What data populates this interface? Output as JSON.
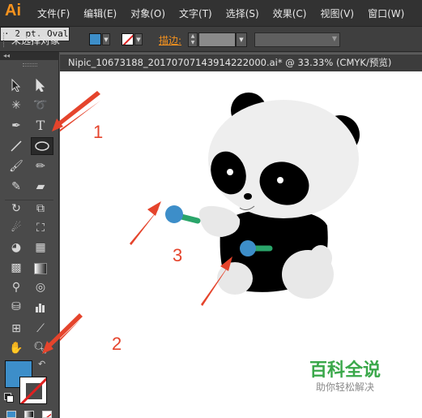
{
  "app": {
    "logo": "Ai"
  },
  "menu": [
    "文件(F)",
    "编辑(E)",
    "对象(O)",
    "文字(T)",
    "选择(S)",
    "效果(C)",
    "视图(V)",
    "窗口(W)"
  ],
  "control_bar": {
    "selection_status": "未选择对象",
    "stroke_label": "描边:",
    "stroke_profile": "· 2 pt. Oval",
    "fill_color": "#3d8ec9"
  },
  "tools_panel": {
    "collapse": "◂◂",
    "tools": [
      "selection-tool",
      "direct-selection-tool",
      "magic-wand-tool",
      "lasso-tool",
      "pen-tool",
      "type-tool",
      "line-segment-tool",
      "ellipse-tool",
      "paintbrush-tool",
      "pencil-tool",
      "blob-brush-tool",
      "eraser-tool",
      "rotate-tool",
      "scale-tool",
      "warp-tool",
      "free-transform-tool",
      "shape-builder-tool",
      "perspective-grid-tool",
      "mesh-tool",
      "gradient-tool",
      "eyedropper-tool",
      "blend-tool",
      "symbol-sprayer-tool",
      "column-graph-tool",
      "artboard-tool",
      "slice-tool",
      "hand-tool",
      "zoom-tool"
    ],
    "selected_tool": "ellipse-tool"
  },
  "document": {
    "tab_title": "Nipic_10673188_20170707143914222000.ai*  @  33.33%  (CMYK/预览)"
  },
  "annotations": {
    "n1": "1",
    "n2": "2",
    "n3": "3"
  },
  "watermark": {
    "title": "百科全说",
    "subtitle": "助你轻松解决"
  },
  "colors": {
    "accent_orange": "#f7931e",
    "annotation_red": "#e5442c",
    "panda_blue": "#3d8ec9",
    "panda_green": "#2aa56a"
  }
}
